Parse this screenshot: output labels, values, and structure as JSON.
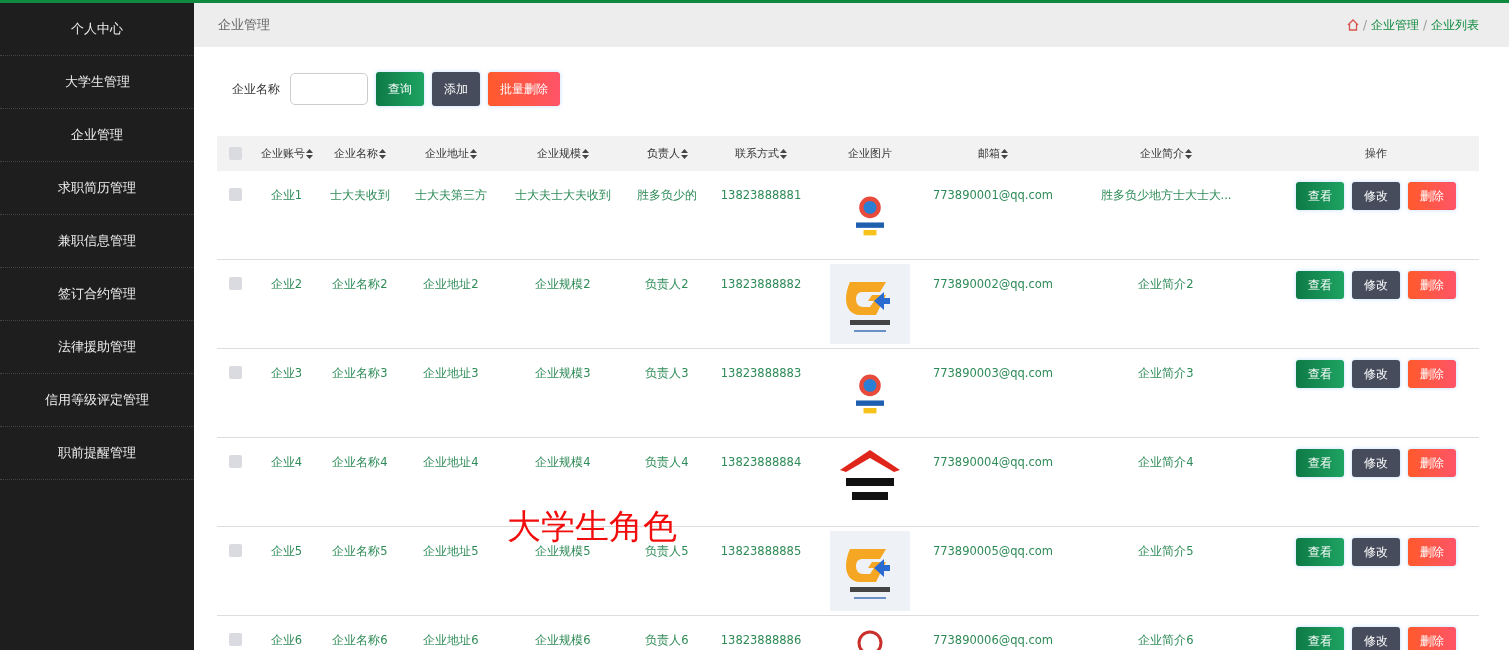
{
  "sidebar": {
    "items": [
      {
        "label": "个人中心",
        "selected": false
      },
      {
        "label": "大学生管理",
        "selected": false
      },
      {
        "label": "企业管理",
        "selected": false
      },
      {
        "label": "求职简历管理",
        "selected": false
      },
      {
        "label": "兼职信息管理",
        "selected": false
      },
      {
        "label": "签订合约管理",
        "selected": false
      },
      {
        "label": "法律援助管理",
        "selected": false
      },
      {
        "label": "信用等级评定管理",
        "selected": false
      },
      {
        "label": "职前提醒管理",
        "selected": false
      }
    ]
  },
  "header": {
    "title": "企业管理",
    "breadcrumb": [
      {
        "separator": "/",
        "label": "企业管理"
      },
      {
        "separator": "/",
        "label": "企业列表"
      }
    ]
  },
  "search": {
    "label": "企业名称",
    "buttons": [
      {
        "label": "查询",
        "kind": "primary"
      },
      {
        "label": "添加",
        "kind": "dark"
      },
      {
        "label": "批量删除",
        "kind": "danger"
      }
    ]
  },
  "table": {
    "select_all": {
      "checked": false
    },
    "columns": [
      {
        "label": "企业账号",
        "sortable": true
      },
      {
        "label": "企业名称",
        "sortable": true
      },
      {
        "label": "企业地址",
        "sortable": true
      },
      {
        "label": "企业规模",
        "sortable": true
      },
      {
        "label": "负责人",
        "sortable": true
      },
      {
        "label": "联系方式",
        "sortable": true
      },
      {
        "label": "企业图片",
        "sortable": false
      },
      {
        "label": "邮箱",
        "sortable": true
      },
      {
        "label": "企业简介",
        "sortable": true
      },
      {
        "label": "操作",
        "sortable": false
      }
    ],
    "rows": [
      {
        "checked": false,
        "cells": [
          "企业1",
          "士大夫收到",
          "士大夫第三方",
          "士大夫士大夫收到",
          "胜多负少的",
          "13823888881"
        ],
        "email": "773890001@qq.com",
        "intro": "胜多负少地方士大士大...",
        "actions": [
          {
            "label": "查看",
            "kind": "primary"
          },
          {
            "label": "修改",
            "kind": "dark"
          },
          {
            "label": "删除",
            "kind": "danger"
          }
        ]
      },
      {
        "checked": false,
        "cells": [
          "企业2",
          "企业名称2",
          "企业地址2",
          "企业规模2",
          "负责人2",
          "13823888882"
        ],
        "email": "773890002@qq.com",
        "intro": "企业简介2",
        "actions": [
          {
            "label": "查看",
            "kind": "primary"
          },
          {
            "label": "修改",
            "kind": "dark"
          },
          {
            "label": "删除",
            "kind": "danger"
          }
        ]
      },
      {
        "checked": false,
        "cells": [
          "企业3",
          "企业名称3",
          "企业地址3",
          "企业规模3",
          "负责人3",
          "13823888883"
        ],
        "email": "773890003@qq.com",
        "intro": "企业简介3",
        "actions": [
          {
            "label": "查看",
            "kind": "primary"
          },
          {
            "label": "修改",
            "kind": "dark"
          },
          {
            "label": "删除",
            "kind": "danger"
          }
        ]
      },
      {
        "checked": false,
        "cells": [
          "企业4",
          "企业名称4",
          "企业地址4",
          "企业规模4",
          "负责人4",
          "13823888884"
        ],
        "email": "773890004@qq.com",
        "intro": "企业简介4",
        "actions": [
          {
            "label": "查看",
            "kind": "primary"
          },
          {
            "label": "修改",
            "kind": "dark"
          },
          {
            "label": "删除",
            "kind": "danger"
          }
        ]
      },
      {
        "checked": false,
        "cells": [
          "企业5",
          "企业名称5",
          "企业地址5",
          "企业规模5",
          "负责人5",
          "13823888885"
        ],
        "email": "773890005@qq.com",
        "intro": "企业简介5",
        "actions": [
          {
            "label": "查看",
            "kind": "primary"
          },
          {
            "label": "修改",
            "kind": "dark"
          },
          {
            "label": "删除",
            "kind": "danger"
          }
        ]
      },
      {
        "checked": false,
        "cells": [
          "企业6",
          "企业名称6",
          "企业地址6",
          "企业规模6",
          "负责人6",
          "13823888886"
        ],
        "email": "773890006@qq.com",
        "intro": "企业简介6",
        "actions": [
          {
            "label": "查看",
            "kind": "primary"
          },
          {
            "label": "修改",
            "kind": "dark"
          },
          {
            "label": "删除",
            "kind": "danger"
          }
        ]
      }
    ]
  },
  "overlay_caption": "大学生角色"
}
